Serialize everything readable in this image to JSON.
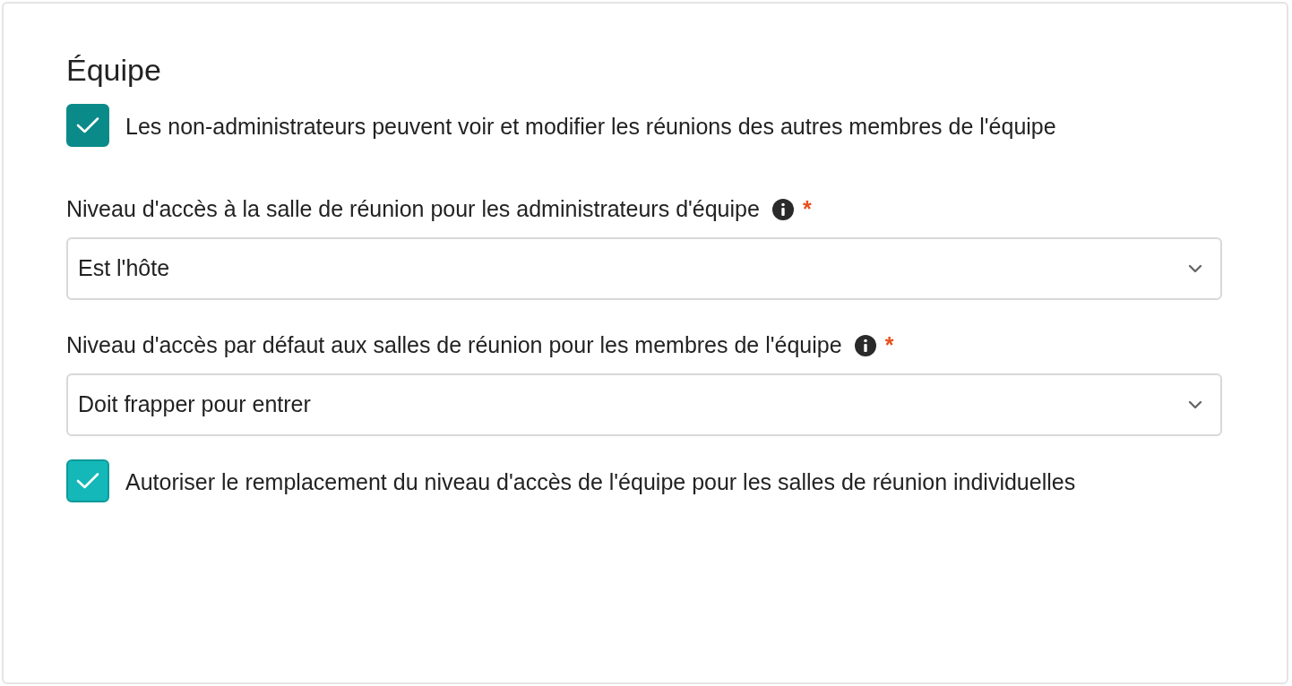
{
  "section": {
    "title": "Équipe"
  },
  "items": [
    {
      "kind": "checkbox",
      "label": "Les non-administrateurs peuvent voir et modifier les réunions des autres membres de l'équipe",
      "checked": true,
      "highlighted": false
    },
    {
      "kind": "select",
      "label": "Niveau d'accès à la salle de réunion pour les administrateurs d'équipe",
      "required_mark": "*",
      "value": "Est l'hôte"
    },
    {
      "kind": "select",
      "label": "Niveau d'accès par défaut aux salles de réunion pour les membres de l'équipe",
      "required_mark": "*",
      "value": "Doit frapper pour entrer"
    },
    {
      "kind": "checkbox",
      "label": "Autoriser le remplacement du niveau d'accès de l'équipe pour les salles de réunion individuelles",
      "checked": true,
      "highlighted": true
    }
  ]
}
